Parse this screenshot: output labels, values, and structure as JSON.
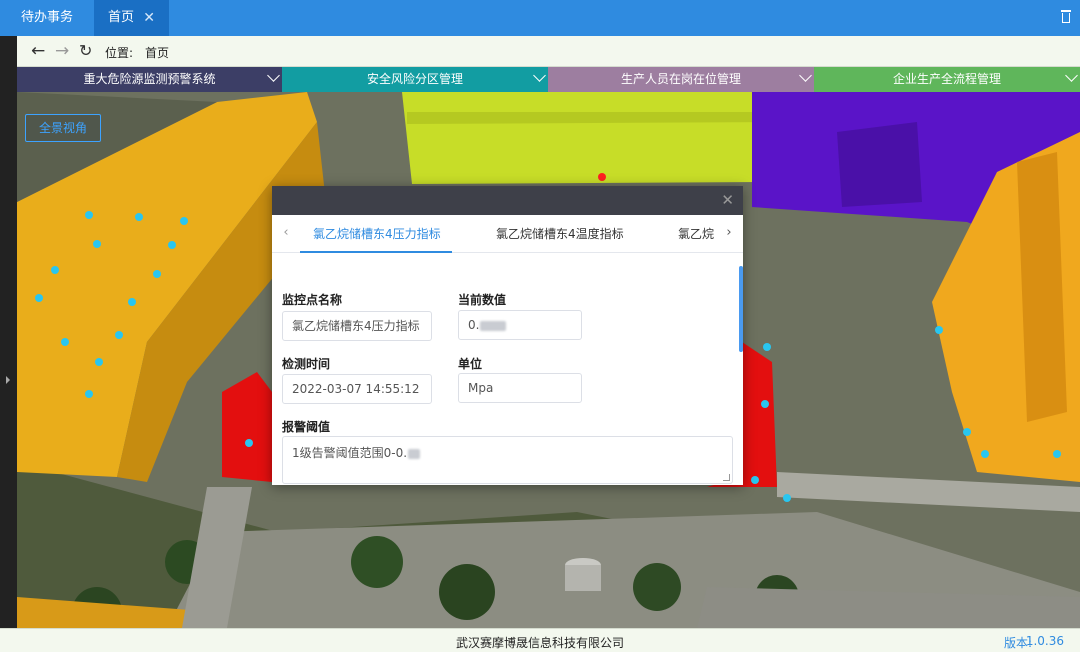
{
  "top_tabs": [
    {
      "label": "待办事务"
    },
    {
      "label": "首页",
      "close": "✕"
    }
  ],
  "nav": {
    "back_icon": "arrow-left-icon",
    "forward_icon": "arrow-right-icon",
    "reload_icon": "reload-icon",
    "location_label": "位置:",
    "location_value": "首页"
  },
  "modules": [
    {
      "label": "重大危险源监测预警系统",
      "color": "#3c3e66"
    },
    {
      "label": "安全风险分区管理",
      "color": "#129da2"
    },
    {
      "label": "生产人员在岗在位管理",
      "color": "#9d7ea0"
    },
    {
      "label": "企业生产全流程管理",
      "color": "#5fb65b"
    }
  ],
  "scene": {
    "view_button": "全景视角",
    "zone_colors": [
      "#e9ad1b",
      "#c7dd28",
      "#5a14c8",
      "#e30f0f",
      "#f0a81e"
    ]
  },
  "modal": {
    "close": "✕",
    "tabs": [
      {
        "label": "氯乙烷储槽东4压力指标",
        "active": true
      },
      {
        "label": "氯乙烷储槽东4温度指标",
        "active": false
      },
      {
        "label": "氯乙烷",
        "active": false
      }
    ],
    "fields": {
      "name_label": "监控点名称",
      "name_value": "氯乙烷储槽东4压力指标",
      "current_label": "当前数值",
      "current_value": "0.",
      "time_label": "检测时间",
      "time_value": "2022-03-07 14:55:12",
      "unit_label": "单位",
      "unit_value": "Mpa",
      "threshold_label": "报警阈值",
      "threshold_value": "1级告警阈值范围0-0."
    }
  },
  "footer": {
    "company": "武汉赛摩博晟信息科技有限公司",
    "version_label": "版本:",
    "version_value": "1.0.36"
  }
}
